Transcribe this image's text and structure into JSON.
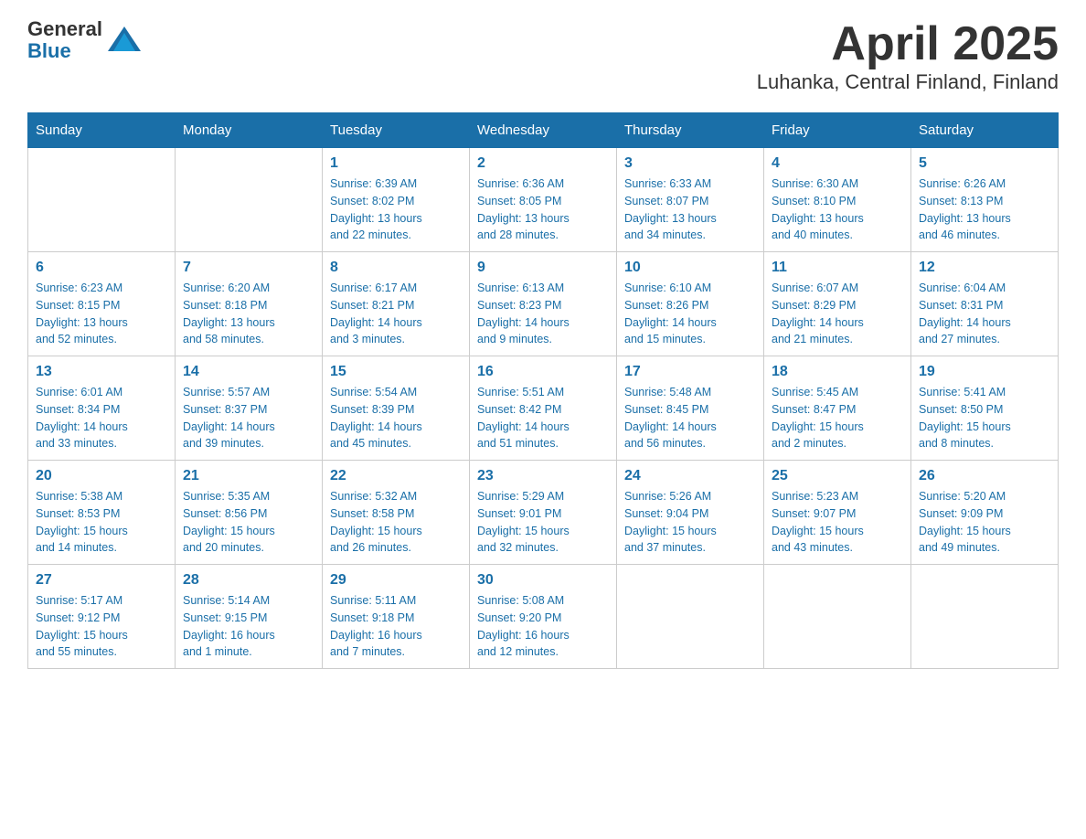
{
  "logo": {
    "text_general": "General",
    "text_blue": "Blue"
  },
  "title": "April 2025",
  "subtitle": "Luhanka, Central Finland, Finland",
  "days_of_week": [
    "Sunday",
    "Monday",
    "Tuesday",
    "Wednesday",
    "Thursday",
    "Friday",
    "Saturday"
  ],
  "weeks": [
    [
      {
        "day": "",
        "info": ""
      },
      {
        "day": "",
        "info": ""
      },
      {
        "day": "1",
        "info": "Sunrise: 6:39 AM\nSunset: 8:02 PM\nDaylight: 13 hours\nand 22 minutes."
      },
      {
        "day": "2",
        "info": "Sunrise: 6:36 AM\nSunset: 8:05 PM\nDaylight: 13 hours\nand 28 minutes."
      },
      {
        "day": "3",
        "info": "Sunrise: 6:33 AM\nSunset: 8:07 PM\nDaylight: 13 hours\nand 34 minutes."
      },
      {
        "day": "4",
        "info": "Sunrise: 6:30 AM\nSunset: 8:10 PM\nDaylight: 13 hours\nand 40 minutes."
      },
      {
        "day": "5",
        "info": "Sunrise: 6:26 AM\nSunset: 8:13 PM\nDaylight: 13 hours\nand 46 minutes."
      }
    ],
    [
      {
        "day": "6",
        "info": "Sunrise: 6:23 AM\nSunset: 8:15 PM\nDaylight: 13 hours\nand 52 minutes."
      },
      {
        "day": "7",
        "info": "Sunrise: 6:20 AM\nSunset: 8:18 PM\nDaylight: 13 hours\nand 58 minutes."
      },
      {
        "day": "8",
        "info": "Sunrise: 6:17 AM\nSunset: 8:21 PM\nDaylight: 14 hours\nand 3 minutes."
      },
      {
        "day": "9",
        "info": "Sunrise: 6:13 AM\nSunset: 8:23 PM\nDaylight: 14 hours\nand 9 minutes."
      },
      {
        "day": "10",
        "info": "Sunrise: 6:10 AM\nSunset: 8:26 PM\nDaylight: 14 hours\nand 15 minutes."
      },
      {
        "day": "11",
        "info": "Sunrise: 6:07 AM\nSunset: 8:29 PM\nDaylight: 14 hours\nand 21 minutes."
      },
      {
        "day": "12",
        "info": "Sunrise: 6:04 AM\nSunset: 8:31 PM\nDaylight: 14 hours\nand 27 minutes."
      }
    ],
    [
      {
        "day": "13",
        "info": "Sunrise: 6:01 AM\nSunset: 8:34 PM\nDaylight: 14 hours\nand 33 minutes."
      },
      {
        "day": "14",
        "info": "Sunrise: 5:57 AM\nSunset: 8:37 PM\nDaylight: 14 hours\nand 39 minutes."
      },
      {
        "day": "15",
        "info": "Sunrise: 5:54 AM\nSunset: 8:39 PM\nDaylight: 14 hours\nand 45 minutes."
      },
      {
        "day": "16",
        "info": "Sunrise: 5:51 AM\nSunset: 8:42 PM\nDaylight: 14 hours\nand 51 minutes."
      },
      {
        "day": "17",
        "info": "Sunrise: 5:48 AM\nSunset: 8:45 PM\nDaylight: 14 hours\nand 56 minutes."
      },
      {
        "day": "18",
        "info": "Sunrise: 5:45 AM\nSunset: 8:47 PM\nDaylight: 15 hours\nand 2 minutes."
      },
      {
        "day": "19",
        "info": "Sunrise: 5:41 AM\nSunset: 8:50 PM\nDaylight: 15 hours\nand 8 minutes."
      }
    ],
    [
      {
        "day": "20",
        "info": "Sunrise: 5:38 AM\nSunset: 8:53 PM\nDaylight: 15 hours\nand 14 minutes."
      },
      {
        "day": "21",
        "info": "Sunrise: 5:35 AM\nSunset: 8:56 PM\nDaylight: 15 hours\nand 20 minutes."
      },
      {
        "day": "22",
        "info": "Sunrise: 5:32 AM\nSunset: 8:58 PM\nDaylight: 15 hours\nand 26 minutes."
      },
      {
        "day": "23",
        "info": "Sunrise: 5:29 AM\nSunset: 9:01 PM\nDaylight: 15 hours\nand 32 minutes."
      },
      {
        "day": "24",
        "info": "Sunrise: 5:26 AM\nSunset: 9:04 PM\nDaylight: 15 hours\nand 37 minutes."
      },
      {
        "day": "25",
        "info": "Sunrise: 5:23 AM\nSunset: 9:07 PM\nDaylight: 15 hours\nand 43 minutes."
      },
      {
        "day": "26",
        "info": "Sunrise: 5:20 AM\nSunset: 9:09 PM\nDaylight: 15 hours\nand 49 minutes."
      }
    ],
    [
      {
        "day": "27",
        "info": "Sunrise: 5:17 AM\nSunset: 9:12 PM\nDaylight: 15 hours\nand 55 minutes."
      },
      {
        "day": "28",
        "info": "Sunrise: 5:14 AM\nSunset: 9:15 PM\nDaylight: 16 hours\nand 1 minute."
      },
      {
        "day": "29",
        "info": "Sunrise: 5:11 AM\nSunset: 9:18 PM\nDaylight: 16 hours\nand 7 minutes."
      },
      {
        "day": "30",
        "info": "Sunrise: 5:08 AM\nSunset: 9:20 PM\nDaylight: 16 hours\nand 12 minutes."
      },
      {
        "day": "",
        "info": ""
      },
      {
        "day": "",
        "info": ""
      },
      {
        "day": "",
        "info": ""
      }
    ]
  ]
}
